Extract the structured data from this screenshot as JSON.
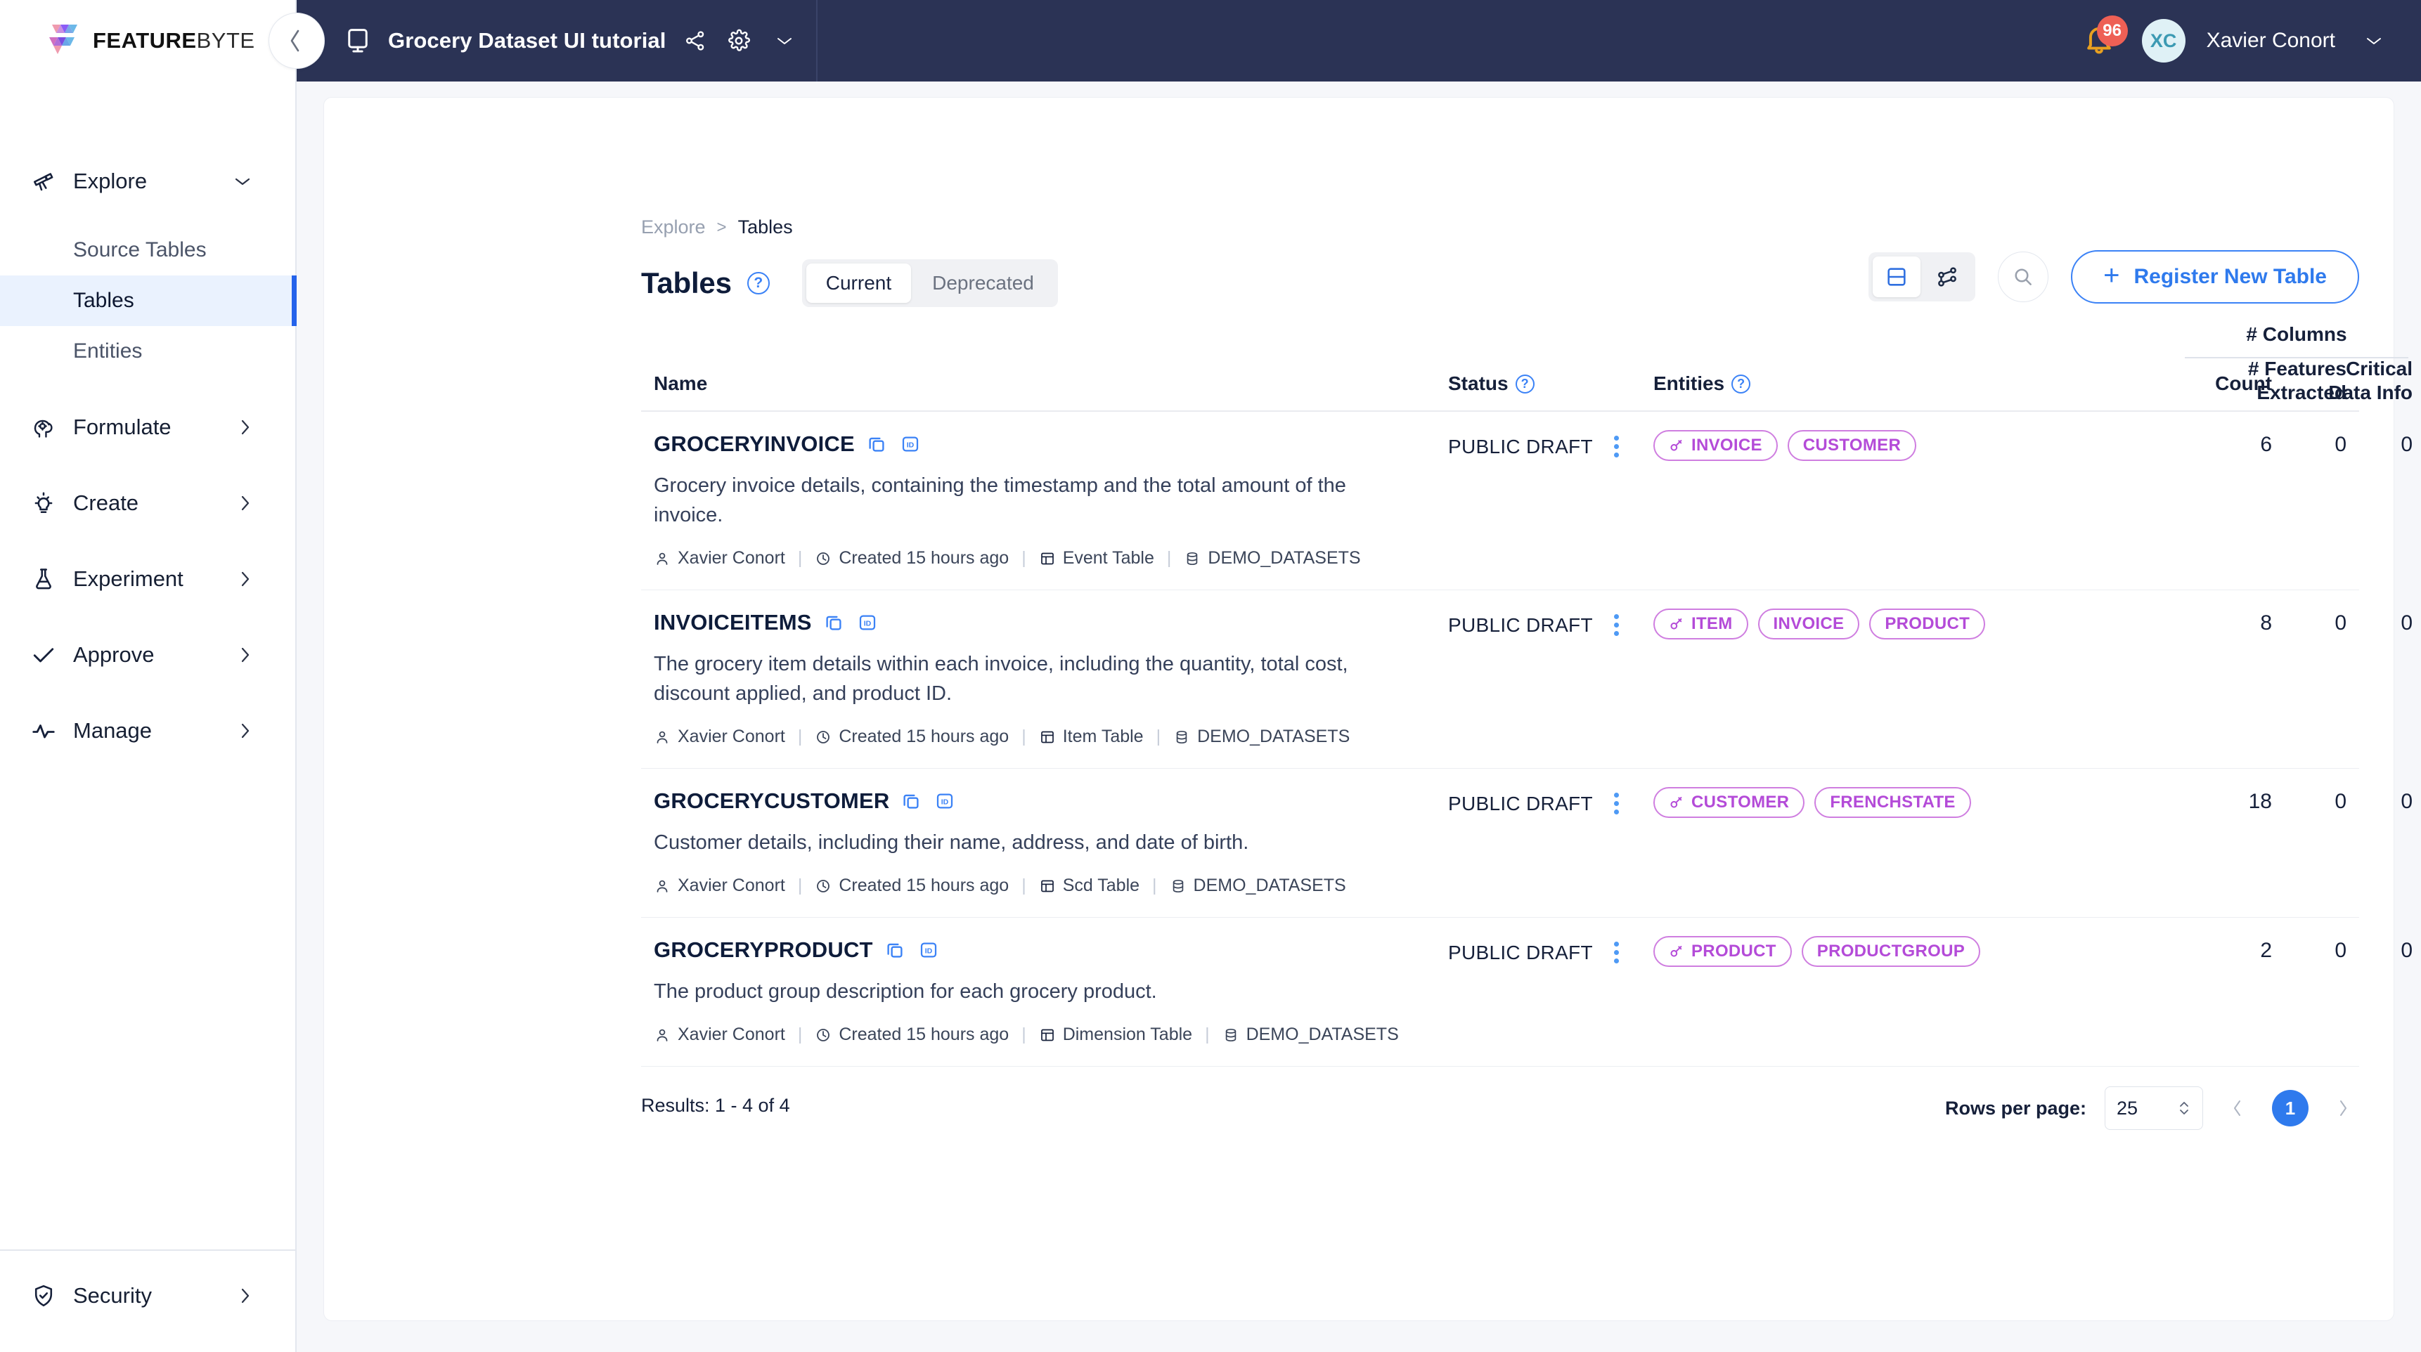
{
  "brand": {
    "name_bold": "FEATURE",
    "name_light": "BYTE",
    "accent_blue": "#2f7aed",
    "entity_purple": "#b44bd8",
    "topbar_bg": "#2b3355"
  },
  "topbar": {
    "project_title": "Grocery Dataset UI tutorial",
    "share_icon": "share-nodes-icon",
    "settings_icon": "gear-icon",
    "dropdown_icon": "chevron-down-icon",
    "notification_count": "96",
    "user_initials": "XC",
    "user_name": "Xavier Conort"
  },
  "sidebar": {
    "groups": [
      {
        "label": "Explore",
        "icon": "telescope-icon",
        "caret": "chevron-down-icon",
        "expanded": true,
        "children": [
          {
            "label": "Source Tables",
            "active": false
          },
          {
            "label": "Tables",
            "active": true
          },
          {
            "label": "Entities",
            "active": false
          }
        ]
      },
      {
        "label": "Formulate",
        "icon": "brain-gear-icon",
        "caret": "chevron-right-icon",
        "expanded": false,
        "children": []
      },
      {
        "label": "Create",
        "icon": "lightbulb-icon",
        "caret": "chevron-right-icon",
        "expanded": false,
        "children": []
      },
      {
        "label": "Experiment",
        "icon": "flask-icon",
        "caret": "chevron-right-icon",
        "expanded": false,
        "children": []
      },
      {
        "label": "Approve",
        "icon": "check-icon",
        "caret": "chevron-right-icon",
        "expanded": false,
        "children": []
      },
      {
        "label": "Manage",
        "icon": "activity-icon",
        "caret": "chevron-right-icon",
        "expanded": false,
        "children": []
      }
    ],
    "bottom": {
      "label": "Security",
      "icon": "shield-check-icon",
      "caret": "chevron-right-icon"
    }
  },
  "breadcrumb": {
    "parent": "Explore",
    "separator": ">",
    "current": "Tables"
  },
  "page": {
    "title": "Tables",
    "title_help_icon": "question-circle-icon",
    "tabs": [
      {
        "label": "Current",
        "active": true
      },
      {
        "label": "Deprecated",
        "active": false
      }
    ]
  },
  "toolbar": {
    "view_list_icon": "list-view-icon",
    "view_graph_icon": "graph-view-icon",
    "search_icon": "search-icon",
    "register_label": "Register New Table",
    "register_plus_icon": "plus-icon"
  },
  "table": {
    "column_group": "# Columns",
    "headers": {
      "name": "Name",
      "status": "Status",
      "entities": "Entities",
      "count": "Count",
      "critical_line1": "Critical",
      "critical_line2": "Data Info",
      "features_line1": "# Features",
      "features_line2": "Extracted"
    },
    "rows": [
      {
        "name": "GROCERYINVOICE",
        "copy_icon": "copy-icon",
        "id_icon": "id-icon",
        "description": "Grocery invoice details, containing the timestamp and the total amount of the invoice.",
        "status": "PUBLIC DRAFT",
        "menu_icon": "kebab-menu-icon",
        "entities": [
          {
            "label": "INVOICE",
            "primary": true
          },
          {
            "label": "CUSTOMER",
            "primary": false
          }
        ],
        "meta": {
          "author": "Xavier Conort",
          "author_icon": "user-icon",
          "created": "Created 15 hours ago",
          "created_icon": "clock-icon",
          "table_type": "Event Table",
          "table_type_icon": "table-icon",
          "source": "DEMO_DATASETS",
          "source_icon": "database-icon"
        },
        "count": "6",
        "critical_data_info": "0",
        "features_extracted": "0"
      },
      {
        "name": "INVOICEITEMS",
        "copy_icon": "copy-icon",
        "id_icon": "id-icon",
        "description": "The grocery item details within each invoice, including the quantity, total cost, discount applied, and product ID.",
        "status": "PUBLIC DRAFT",
        "menu_icon": "kebab-menu-icon",
        "entities": [
          {
            "label": "ITEM",
            "primary": true
          },
          {
            "label": "INVOICE",
            "primary": false
          },
          {
            "label": "PRODUCT",
            "primary": false
          }
        ],
        "meta": {
          "author": "Xavier Conort",
          "author_icon": "user-icon",
          "created": "Created 15 hours ago",
          "created_icon": "clock-icon",
          "table_type": "Item Table",
          "table_type_icon": "table-icon",
          "source": "DEMO_DATASETS",
          "source_icon": "database-icon"
        },
        "count": "8",
        "critical_data_info": "0",
        "features_extracted": "0"
      },
      {
        "name": "GROCERYCUSTOMER",
        "copy_icon": "copy-icon",
        "id_icon": "id-icon",
        "description": "Customer details, including their name, address, and date of birth.",
        "status": "PUBLIC DRAFT",
        "menu_icon": "kebab-menu-icon",
        "entities": [
          {
            "label": "CUSTOMER",
            "primary": true
          },
          {
            "label": "FRENCHSTATE",
            "primary": false
          }
        ],
        "meta": {
          "author": "Xavier Conort",
          "author_icon": "user-icon",
          "created": "Created 15 hours ago",
          "created_icon": "clock-icon",
          "table_type": "Scd Table",
          "table_type_icon": "table-icon",
          "source": "DEMO_DATASETS",
          "source_icon": "database-icon"
        },
        "count": "18",
        "critical_data_info": "0",
        "features_extracted": "0"
      },
      {
        "name": "GROCERYPRODUCT",
        "copy_icon": "copy-icon",
        "id_icon": "id-icon",
        "description": "The product group description for each grocery product.",
        "status": "PUBLIC DRAFT",
        "menu_icon": "kebab-menu-icon",
        "entities": [
          {
            "label": "PRODUCT",
            "primary": true
          },
          {
            "label": "PRODUCTGROUP",
            "primary": false
          }
        ],
        "meta": {
          "author": "Xavier Conort",
          "author_icon": "user-icon",
          "created": "Created 15 hours ago",
          "created_icon": "clock-icon",
          "table_type": "Dimension Table",
          "table_type_icon": "table-icon",
          "source": "DEMO_DATASETS",
          "source_icon": "database-icon"
        },
        "count": "2",
        "critical_data_info": "0",
        "features_extracted": "0"
      }
    ]
  },
  "footer": {
    "results": "Results: 1 - 4 of 4",
    "rows_per_page_label": "Rows per page:",
    "rows_per_page_value": "25",
    "prev_icon": "chevron-left-icon",
    "next_icon": "chevron-right-icon",
    "current_page": "1"
  }
}
